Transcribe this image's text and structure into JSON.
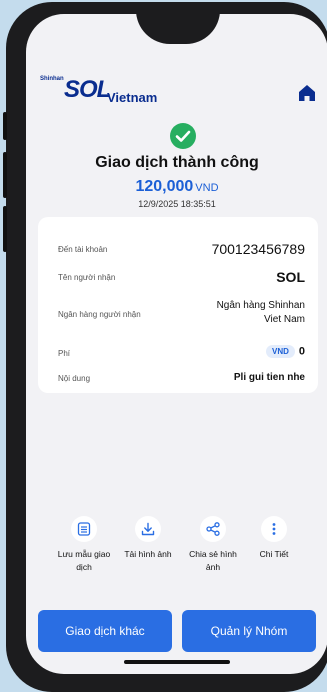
{
  "header": {
    "logo_small": "Shinhan",
    "logo_big": "SOL",
    "logo_country": "Vietnam",
    "home_icon": "home-icon"
  },
  "status": {
    "icon": "check-circle-icon",
    "title": "Giao dịch thành công",
    "amount": "120,000",
    "currency": "VND",
    "datetime": "12/9/2025 18:35:51"
  },
  "details": {
    "account_label": "Đến tài khoản",
    "account_value": "700123456789",
    "recipient_label": "Tên người nhận",
    "recipient_value": "SOL",
    "bank_label": "Ngân hàng người nhận",
    "bank_value_line1": "Ngân hàng Shinhan",
    "bank_value_line2": "Viet Nam",
    "fee_label": "Phí",
    "fee_currency": "VND",
    "fee_value": "0",
    "content_label": "Nội dung",
    "content_value": "Pli gui tien nhe"
  },
  "actions": {
    "save_template_line1": "Lưu mẫu giao",
    "save_template_line2": "dịch",
    "download_image": "Tải hình ảnh",
    "share_image_line1": "Chia sẻ hình",
    "share_image_line2": "ảnh",
    "details": "Chi Tiết"
  },
  "buttons": {
    "other_transaction": "Giao dịch khác",
    "manage_group": "Quản lý Nhóm"
  },
  "colors": {
    "accent": "#2a6ee3",
    "brand": "#0a2d8f",
    "success": "#27ae60",
    "background": "#c4dced"
  }
}
